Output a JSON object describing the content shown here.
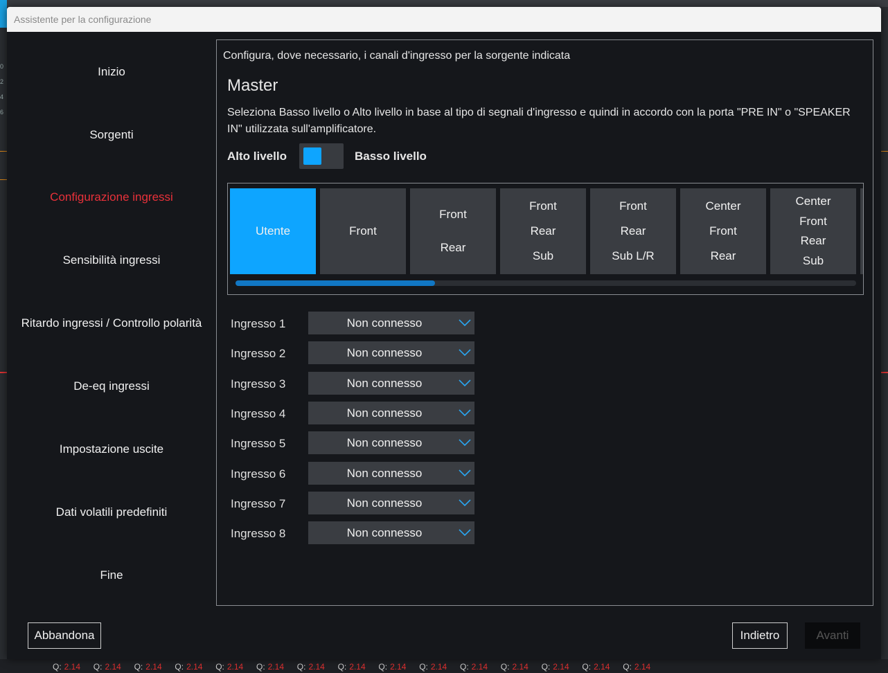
{
  "window": {
    "title": "Assistente per la configurazione"
  },
  "sidebar": {
    "items": [
      {
        "label": "Inizio",
        "active": false
      },
      {
        "label": "Sorgenti",
        "active": false
      },
      {
        "label": "Configurazione ingressi",
        "active": true
      },
      {
        "label": "Sensibilità ingressi",
        "active": false
      },
      {
        "label": "Ritardo ingressi / Controllo polarità",
        "active": false
      },
      {
        "label": "De-eq ingressi",
        "active": false
      },
      {
        "label": "Impostazione uscite",
        "active": false
      },
      {
        "label": "Dati volatili predefiniti",
        "active": false
      },
      {
        "label": "Fine",
        "active": false
      }
    ]
  },
  "main": {
    "subtitle": "Configura, dove necessario, i canali d'ingresso per la sorgente indicata",
    "section_title": "Master",
    "description": "Seleziona Basso livello o Alto livello in base al tipo di segnali d'ingresso e quindi in accordo con la porta \"PRE IN\" o \"SPEAKER IN\" utilizzata sull'amplificatore.",
    "level_toggle": {
      "left_label": "Alto livello",
      "right_label": "Basso livello",
      "selected": "Basso livello"
    },
    "presets": [
      {
        "lines": [
          "Utente"
        ],
        "selected": true
      },
      {
        "lines": [
          "Front"
        ],
        "selected": false
      },
      {
        "lines": [
          "Front",
          "Rear"
        ],
        "selected": false
      },
      {
        "lines": [
          "Front",
          "Rear",
          "Sub"
        ],
        "selected": false
      },
      {
        "lines": [
          "Front",
          "Rear",
          "Sub L/R"
        ],
        "selected": false
      },
      {
        "lines": [
          "Center",
          "Front",
          "Rear"
        ],
        "selected": false
      },
      {
        "lines": [
          "Center",
          "Front",
          "Rear",
          "Sub"
        ],
        "selected": false
      }
    ],
    "inputs": [
      {
        "label": "Ingresso 1",
        "value": "Non connesso"
      },
      {
        "label": "Ingresso 2",
        "value": "Non connesso"
      },
      {
        "label": "Ingresso 3",
        "value": "Non connesso"
      },
      {
        "label": "Ingresso 4",
        "value": "Non connesso"
      },
      {
        "label": "Ingresso 5",
        "value": "Non connesso"
      },
      {
        "label": "Ingresso 6",
        "value": "Non connesso"
      },
      {
        "label": "Ingresso 7",
        "value": "Non connesso"
      },
      {
        "label": "Ingresso 8",
        "value": "Non connesso"
      }
    ]
  },
  "footer": {
    "abandon_label": "Abbandona",
    "back_label": "Indietro",
    "next_label": "Avanti",
    "next_enabled": false
  },
  "background": {
    "left_numbers": [
      "0",
      "2",
      "4",
      "6"
    ],
    "q_items": [
      "Q:",
      "2.14"
    ],
    "q_count": 15
  },
  "colors": {
    "accent": "#0ea5ff",
    "active_nav": "#e8313a",
    "dialog_bg": "#15171b",
    "tile_bg": "#3a3d42"
  }
}
